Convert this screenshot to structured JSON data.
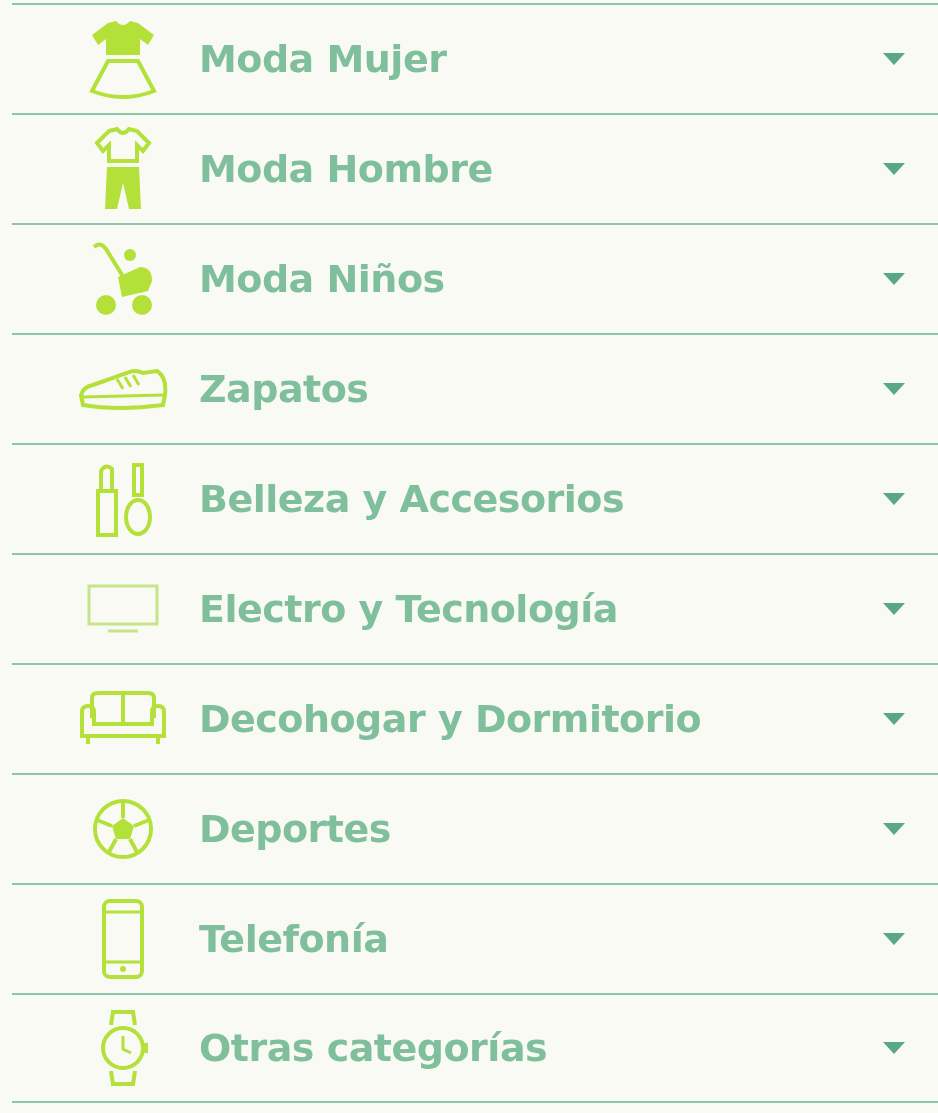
{
  "categories": [
    {
      "label": "Moda Mujer"
    },
    {
      "label": "Moda Hombre"
    },
    {
      "label": "Moda Niños"
    },
    {
      "label": "Zapatos"
    },
    {
      "label": "Belleza y Accesorios"
    },
    {
      "label": "Electro y Tecnología"
    },
    {
      "label": "Decohogar y Dormitorio"
    },
    {
      "label": "Deportes"
    },
    {
      "label": "Telefonía"
    },
    {
      "label": "Otras categorías"
    }
  ]
}
